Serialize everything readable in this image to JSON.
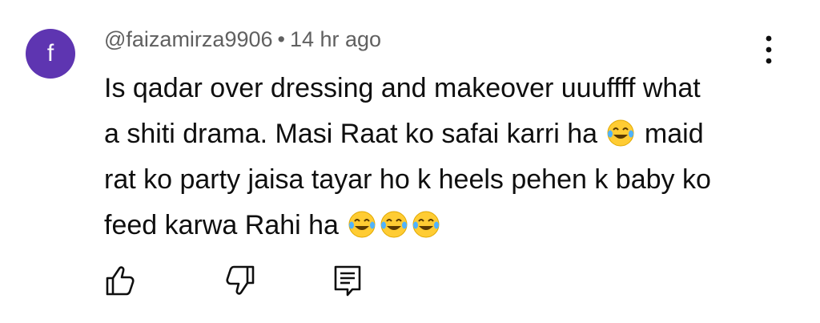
{
  "comment": {
    "avatar_letter": "f",
    "avatar_color": "#5e35b1",
    "author": "@faizamirza9906",
    "separator": "•",
    "time": "14 hr ago",
    "text_line1": "Is qadar over dressing and makeover uuuffff what",
    "text_line2": "a shiti drama. Masi Raat ko safai karri ha",
    "text_line2_after": " maid",
    "text_line3": "rat ko party jaisa tayar ho k heels pehen k baby ko",
    "text_line4": "feed karwa Rahi ha",
    "emoji": "face-with-tears-of-joy"
  },
  "icons": {
    "more": "more-vertical-icon",
    "like": "thumbs-up-icon",
    "dislike": "thumbs-down-icon",
    "reply": "reply-comment-icon"
  }
}
